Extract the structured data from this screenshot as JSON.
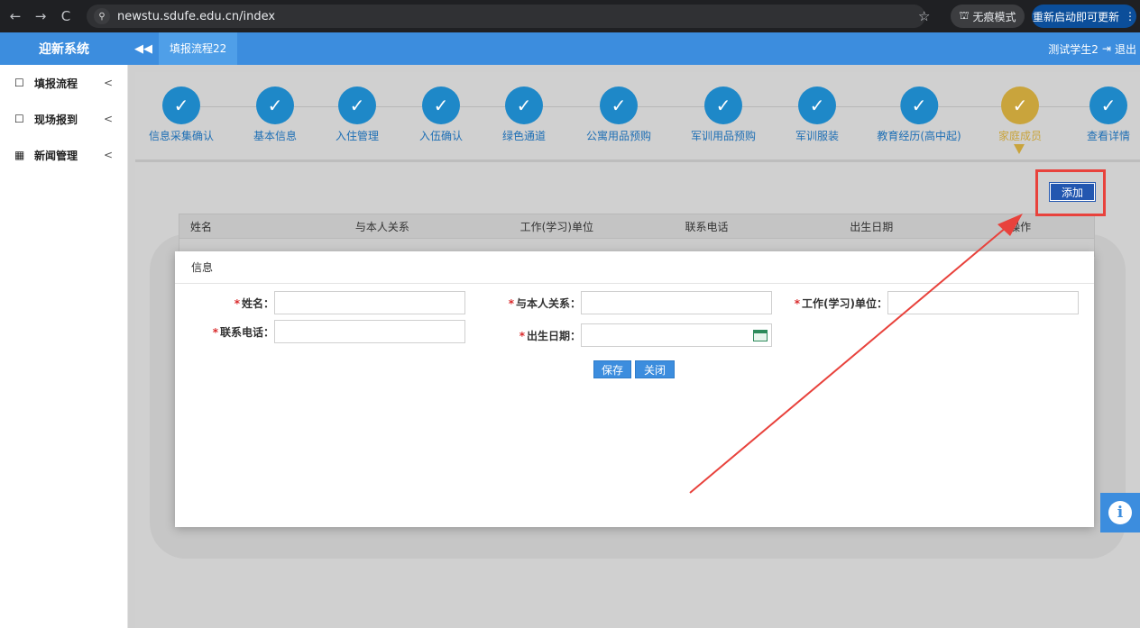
{
  "browser": {
    "back": "←",
    "forward": "→",
    "reload": "C",
    "site_icon": "⚲",
    "url": "newstu.sdufe.edu.cn/index",
    "star": "☆",
    "incognito_label": "无痕模式",
    "incognito_icon": "⛫",
    "update_label": "重新启动即可更新",
    "menu": "⋮"
  },
  "header": {
    "brand": "迎新系统",
    "collapse": "◀◀",
    "active_tab": "填报流程22",
    "user": "测试学生2",
    "logout": "退出",
    "logout_icon": "⇥"
  },
  "sidebar": {
    "items": [
      {
        "icon": "☐",
        "label": "填报流程",
        "chev": "<"
      },
      {
        "icon": "☐",
        "label": "现场报到",
        "chev": "<"
      },
      {
        "icon": "▦",
        "label": "新闻管理",
        "chev": "<"
      }
    ]
  },
  "steps": [
    {
      "label": "信息采集确认",
      "mark": "✓"
    },
    {
      "label": "基本信息",
      "mark": "✓"
    },
    {
      "label": "入住管理",
      "mark": "✓"
    },
    {
      "label": "入伍确认",
      "mark": "✓"
    },
    {
      "label": "绿色通道",
      "mark": "✓"
    },
    {
      "label": "公寓用品预购",
      "mark": "✓"
    },
    {
      "label": "军训用品预购",
      "mark": "✓"
    },
    {
      "label": "军训服装",
      "mark": "✓"
    },
    {
      "label": "教育经历(高中起)",
      "mark": "✓"
    },
    {
      "label": "家庭成员",
      "mark": "✓"
    },
    {
      "label": "查看详情",
      "mark": "✓"
    }
  ],
  "add_button": "添加",
  "table": {
    "headers": [
      "姓名",
      "与本人关系",
      "工作(学习)单位",
      "联系电话",
      "出生日期",
      "操作"
    ]
  },
  "modal": {
    "title": "信息",
    "required_mark": "*",
    "fields": {
      "name": "姓名：",
      "relation": "与本人关系：",
      "work": "工作(学习)单位：",
      "phone": "联系电话：",
      "birth": "出生日期："
    },
    "save": "保存",
    "close": "关闭"
  },
  "info_icon": "i",
  "colors": {
    "primary": "#3c8dde",
    "step_done": "#1e88c8",
    "step_current": "#c9a43c",
    "annotation": "#e8423c"
  }
}
